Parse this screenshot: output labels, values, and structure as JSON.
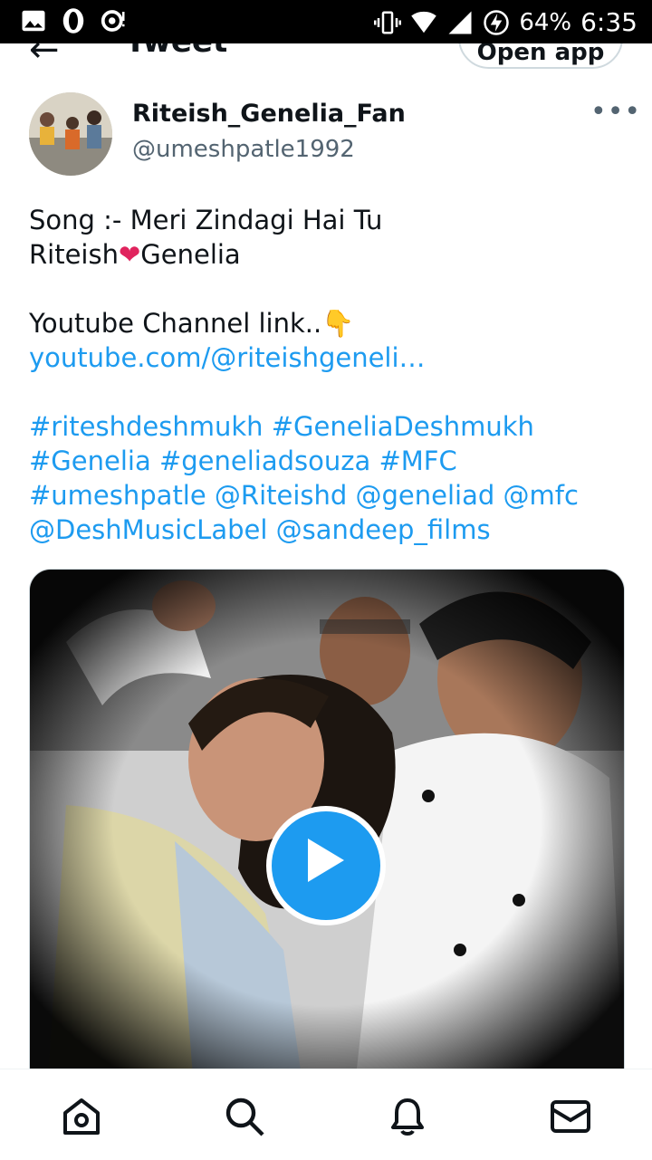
{
  "status_bar": {
    "battery": "64%",
    "time": "6:35"
  },
  "header": {
    "title": "Tweet",
    "open_app_label": "Open app"
  },
  "author": {
    "name": "Riteish_Genelia_Fan",
    "handle": "@umeshpatle1992"
  },
  "tweet": {
    "line1": "Song :- Meri Zindagi Hai Tu",
    "line2_a": "Riteish",
    "line2_heart": "❤",
    "line2_b": "Genelia",
    "line3": "Youtube Channel link..",
    "line3_emoji": "👇",
    "link": "youtube.com/@riteishgeneli…",
    "tags_line1": "#riteshdeshmukh #GeneliaDeshmukh",
    "tags_line2": "#Genelia #geneliadsouza #MFC",
    "tags_line3": "#umeshpatle @Riteishd @geneliad @mfc",
    "tags_line4": "@DeshMusicLabel @sandeep_films"
  },
  "colors": {
    "accent": "#1d9bf0",
    "text": "#0f1419",
    "secondary": "#536471"
  },
  "bottom_nav": [
    "home-icon",
    "search-icon",
    "notifications-icon",
    "messages-icon"
  ]
}
